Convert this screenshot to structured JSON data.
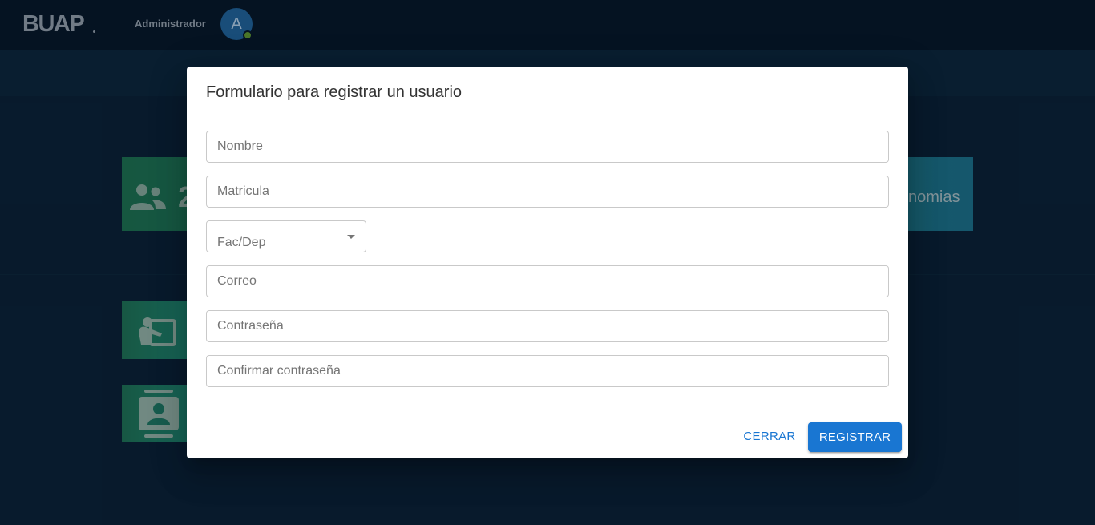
{
  "header": {
    "logo_text": "BUAP",
    "user_name": "Administrador",
    "avatar_initial": "A"
  },
  "background": {
    "stat_tile": {
      "number_partial": "2",
      "label_partial": "nomias"
    }
  },
  "dialog": {
    "title": "Formulario para registrar un usuario",
    "fields": {
      "nombre": {
        "placeholder": "Nombre",
        "value": ""
      },
      "matricula": {
        "placeholder": "Matricula",
        "value": ""
      },
      "fac_dep": {
        "label": "Fac/Dep",
        "selected": ""
      },
      "correo": {
        "placeholder": "Correo",
        "value": ""
      },
      "contrasena": {
        "placeholder": "Contraseña",
        "value": ""
      },
      "confirmar": {
        "placeholder": "Confirmar contraseña",
        "value": ""
      }
    },
    "buttons": {
      "close_label": "CERRAR",
      "submit_label": "REGISTRAR"
    }
  },
  "colors": {
    "accent": "#1976d2",
    "status_online": "#5b8f2f",
    "background_dark": "#0a1f33"
  }
}
